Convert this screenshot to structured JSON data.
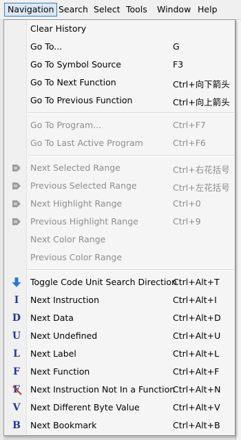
{
  "menubar": [
    "Navigation",
    "Search",
    "Select",
    "Tools",
    "Window",
    "Help"
  ],
  "groups": [
    [
      {
        "label": "Clear History",
        "shortcut": "",
        "disabled": false,
        "icon": null
      },
      {
        "label": "Go To...",
        "shortcut": "G",
        "disabled": false,
        "icon": null
      },
      {
        "label": "Go To Symbol Source",
        "shortcut": "F3",
        "disabled": false,
        "icon": null
      },
      {
        "label": "Go To Next Function",
        "shortcut": "Ctrl+向下箭头",
        "disabled": false,
        "icon": null
      },
      {
        "label": "Go To Previous Function",
        "shortcut": "Ctrl+向上箭头",
        "disabled": false,
        "icon": null
      }
    ],
    [
      {
        "label": "Go To Program...",
        "shortcut": "Ctrl+F7",
        "disabled": true,
        "icon": null
      },
      {
        "label": "Go To Last Active Program",
        "shortcut": "Ctrl+F6",
        "disabled": true,
        "icon": null
      }
    ],
    [
      {
        "label": "Next Selected Range",
        "shortcut": "Ctrl+右花括号",
        "disabled": true,
        "icon": "range-next-icon"
      },
      {
        "label": "Previous Selected Range",
        "shortcut": "Ctrl+左花括号",
        "disabled": true,
        "icon": "range-prev-icon"
      },
      {
        "label": "Next Highlight Range",
        "shortcut": "Ctrl+0",
        "disabled": true,
        "icon": "highlight-next-icon"
      },
      {
        "label": "Previous Highlight Range",
        "shortcut": "Ctrl+9",
        "disabled": true,
        "icon": "highlight-prev-icon"
      },
      {
        "label": "Next Color Range",
        "shortcut": "",
        "disabled": true,
        "icon": null
      },
      {
        "label": "Previous Color Range",
        "shortcut": "",
        "disabled": true,
        "icon": null
      }
    ],
    [
      {
        "label": "Toggle Code Unit Search Direction",
        "shortcut": "Ctrl+Alt+T",
        "disabled": false,
        "icon": "down-arrow-icon"
      },
      {
        "label": "Next Instruction",
        "shortcut": "Ctrl+Alt+I",
        "disabled": false,
        "icon": "letter-i-icon",
        "glyph": "I"
      },
      {
        "label": "Next Data",
        "shortcut": "Ctrl+Alt+D",
        "disabled": false,
        "icon": "letter-d-icon",
        "glyph": "D"
      },
      {
        "label": "Next Undefined",
        "shortcut": "Ctrl+Alt+U",
        "disabled": false,
        "icon": "letter-u-icon",
        "glyph": "U"
      },
      {
        "label": "Next Label",
        "shortcut": "Ctrl+Alt+L",
        "disabled": false,
        "icon": "letter-l-icon",
        "glyph": "L"
      },
      {
        "label": "Next Function",
        "shortcut": "Ctrl+Alt+F",
        "disabled": false,
        "icon": "letter-f-icon",
        "glyph": "F"
      },
      {
        "label": "Next Instruction Not In a Function",
        "shortcut": "Ctrl+Alt+N",
        "disabled": false,
        "icon": "letter-f-crossed-icon",
        "glyph": "F"
      },
      {
        "label": "Next Different Byte Value",
        "shortcut": "Ctrl+Alt+V",
        "disabled": false,
        "icon": "letter-v-icon",
        "glyph": "V"
      },
      {
        "label": "Next Bookmark",
        "shortcut": "Ctrl+Alt+B",
        "disabled": false,
        "icon": "letter-b-icon",
        "glyph": "B"
      }
    ]
  ],
  "colors": {
    "icon_blue": "#1a3a9c",
    "arrow_blue": "#2a78d6",
    "disabled_text": "#8d8d8d",
    "range_icon": "#9a9a9a"
  }
}
